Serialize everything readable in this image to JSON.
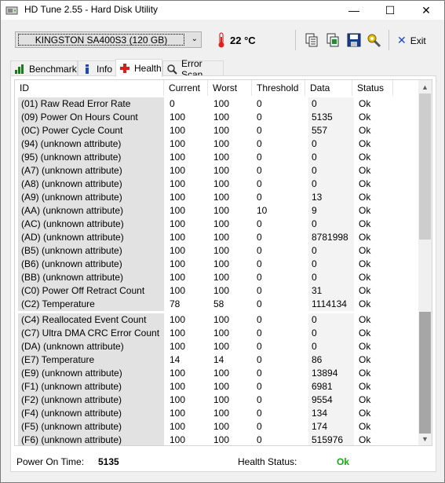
{
  "window": {
    "title": "HD Tune 2.55 - Hard Disk Utility",
    "min_glyph": "—",
    "max_glyph": "☐",
    "close_glyph": "✕"
  },
  "toolbar": {
    "drive": "KINGSTON SA400S3 (120 GB)",
    "temperature": "22 °C",
    "exit_label": "Exit",
    "icons": [
      "copy-info-icon",
      "copy-screen-icon",
      "save-icon",
      "options-icon"
    ]
  },
  "tabs": [
    {
      "label": "Benchmark",
      "icon": "benchmark-icon"
    },
    {
      "label": "Info",
      "icon": "info-icon"
    },
    {
      "label": "Health",
      "icon": "health-icon",
      "active": true
    },
    {
      "label": "Error Scan",
      "icon": "error-scan-icon"
    }
  ],
  "table": {
    "columns": [
      "ID",
      "Current",
      "Worst",
      "Threshold",
      "Data",
      "Status"
    ],
    "rows": [
      [
        "(01) Raw Read Error Rate",
        "0",
        "100",
        "0",
        "0",
        "Ok"
      ],
      [
        "(09) Power On Hours Count",
        "100",
        "100",
        "0",
        "5135",
        "Ok"
      ],
      [
        "(0C) Power Cycle Count",
        "100",
        "100",
        "0",
        "557",
        "Ok"
      ],
      [
        "(94) (unknown attribute)",
        "100",
        "100",
        "0",
        "0",
        "Ok"
      ],
      [
        "(95) (unknown attribute)",
        "100",
        "100",
        "0",
        "0",
        "Ok"
      ],
      [
        "(A7) (unknown attribute)",
        "100",
        "100",
        "0",
        "0",
        "Ok"
      ],
      [
        "(A8) (unknown attribute)",
        "100",
        "100",
        "0",
        "0",
        "Ok"
      ],
      [
        "(A9) (unknown attribute)",
        "100",
        "100",
        "0",
        "13",
        "Ok"
      ],
      [
        "(AA) (unknown attribute)",
        "100",
        "100",
        "10",
        "9",
        "Ok"
      ],
      [
        "(AC) (unknown attribute)",
        "100",
        "100",
        "0",
        "0",
        "Ok"
      ],
      [
        "(AD) (unknown attribute)",
        "100",
        "100",
        "0",
        "8781998",
        "Ok"
      ],
      [
        "(B5) (unknown attribute)",
        "100",
        "100",
        "0",
        "0",
        "Ok"
      ],
      [
        "(B6) (unknown attribute)",
        "100",
        "100",
        "0",
        "0",
        "Ok"
      ],
      [
        "(BB) (unknown attribute)",
        "100",
        "100",
        "0",
        "0",
        "Ok"
      ],
      [
        "(C0) Power Off Retract Count",
        "100",
        "100",
        "0",
        "31",
        "Ok"
      ],
      [
        "(C2) Temperature",
        "78",
        "58",
        "0",
        "1114134",
        "Ok"
      ],
      [
        "(C4) Reallocated Event Count",
        "100",
        "100",
        "0",
        "0",
        "Ok"
      ],
      [
        "(C7) Ultra DMA CRC Error Count",
        "100",
        "100",
        "0",
        "0",
        "Ok"
      ],
      [
        "(DA) (unknown attribute)",
        "100",
        "100",
        "0",
        "0",
        "Ok"
      ],
      [
        "(E7) Temperature",
        "14",
        "14",
        "0",
        "86",
        "Ok"
      ],
      [
        "(E9) (unknown attribute)",
        "100",
        "100",
        "0",
        "13894",
        "Ok"
      ],
      [
        "(F1) (unknown attribute)",
        "100",
        "100",
        "0",
        "6981",
        "Ok"
      ],
      [
        "(F2) (unknown attribute)",
        "100",
        "100",
        "0",
        "9554",
        "Ok"
      ],
      [
        "(F4) (unknown attribute)",
        "100",
        "100",
        "0",
        "134",
        "Ok"
      ],
      [
        "(F5) (unknown attribute)",
        "100",
        "100",
        "0",
        "174",
        "Ok"
      ],
      [
        "(F6) (unknown attribute)",
        "100",
        "100",
        "0",
        "515976",
        "Ok"
      ]
    ]
  },
  "footer": {
    "power_on_label": "Power On Time:",
    "power_on_value": "5135",
    "health_label": "Health Status:",
    "health_value": "Ok"
  },
  "colors": {
    "ok_green": "#12b012",
    "exit_blue": "#1a47c4",
    "health_red": "#d81e1e"
  }
}
